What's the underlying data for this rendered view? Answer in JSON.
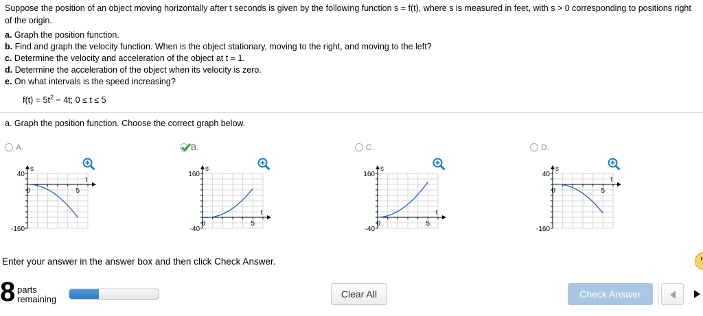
{
  "problem": {
    "intro": "Suppose the position of an object moving horizontally after t seconds is given by the following function s = f(t), where s is measured in feet, with s > 0 corresponding to positions right of the origin.",
    "parts": [
      {
        "letter": "a.",
        "text": "Graph the position function."
      },
      {
        "letter": "b.",
        "text": "Find and graph the velocity function. When is the object stationary, moving to the right, and moving to the left?"
      },
      {
        "letter": "c.",
        "text": "Determine the velocity and acceleration of the object at t = 1."
      },
      {
        "letter": "d.",
        "text": "Determine the acceleration of the object when its velocity is zero."
      },
      {
        "letter": "e.",
        "text": "On what intervals is the speed increasing?"
      }
    ],
    "function_prefix": "f(t) = 5t",
    "function_exp": "2",
    "function_suffix": " − 4t; 0 ≤ t ≤ 5"
  },
  "question": "a. Graph the position function. Choose the correct graph below.",
  "options": [
    {
      "id": "A",
      "label": "A.",
      "selected": false,
      "y_top": "40",
      "y_bottom": "-160",
      "t_tick": "5",
      "y_axis_label": "s",
      "t_axis_label": "t",
      "origin": "0"
    },
    {
      "id": "B",
      "label": "B.",
      "selected": true,
      "y_top": "160",
      "y_bottom": "-40",
      "t_tick": "5",
      "y_axis_label": "s",
      "t_axis_label": "t",
      "origin": "0"
    },
    {
      "id": "C",
      "label": "C.",
      "selected": false,
      "y_top": "160",
      "y_bottom": "-40",
      "t_tick": "5",
      "y_axis_label": "s",
      "t_axis_label": "t",
      "origin": "0"
    },
    {
      "id": "D",
      "label": "D.",
      "selected": false,
      "y_top": "40",
      "y_bottom": "-160",
      "t_tick": "5",
      "y_axis_label": "s",
      "t_axis_label": "t",
      "origin": "0"
    }
  ],
  "instructions": "Enter your answer in the answer box and then click Check Answer.",
  "footer": {
    "parts_count": "8",
    "parts_label_1": "parts",
    "parts_label_2": "remaining",
    "progress_fraction": 0.33,
    "clear_label": "Clear All",
    "check_label": "Check Answer"
  },
  "colors": {
    "curve": "#1f5fbf",
    "check_button": "#a9c7e3",
    "progress": "#2d7cc3",
    "checkmark": "#2ea043"
  }
}
